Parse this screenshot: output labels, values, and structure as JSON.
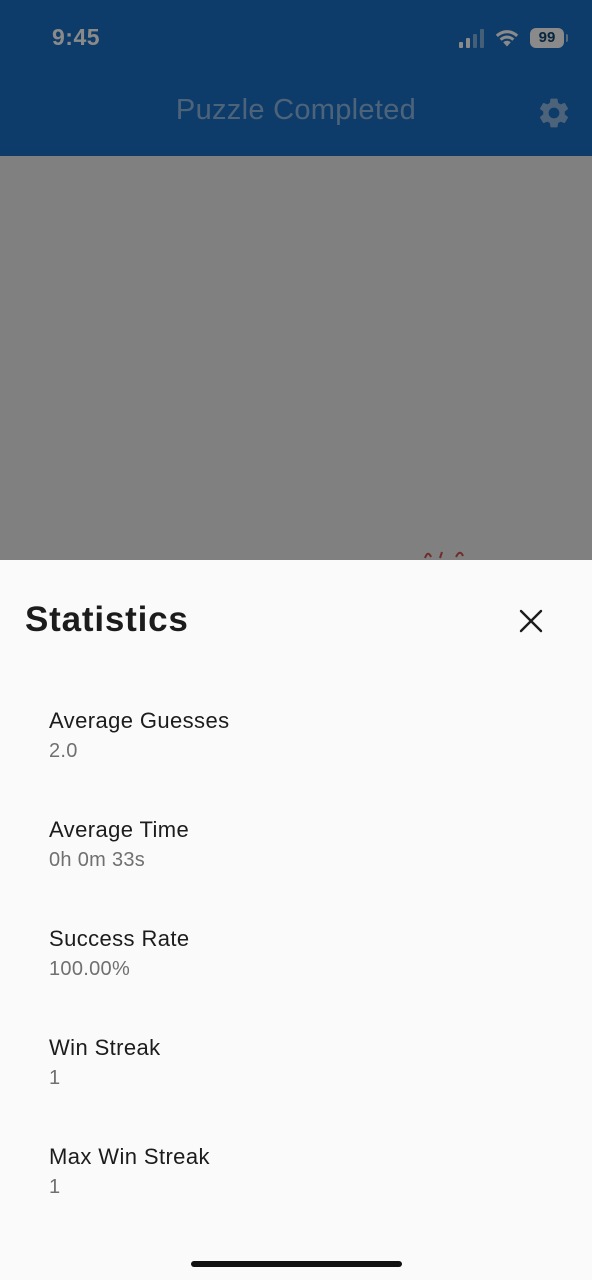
{
  "status_bar": {
    "time": "9:45",
    "battery": "99",
    "icons": [
      "signal-icon",
      "wifi-icon",
      "battery-icon"
    ]
  },
  "app_bar": {
    "title": "Puzzle Completed",
    "settings_icon": "gear-icon",
    "color": "#1a6fc5"
  },
  "sheet": {
    "title": "Statistics",
    "close_icon": "close-icon",
    "stats": [
      {
        "label": "Average Guesses",
        "value": "2.0"
      },
      {
        "label": "Average Time",
        "value": "0h 0m 33s"
      },
      {
        "label": "Success Rate",
        "value": "100.00%"
      },
      {
        "label": "Win Streak",
        "value": "1"
      },
      {
        "label": "Max Win Streak",
        "value": "1"
      }
    ]
  }
}
